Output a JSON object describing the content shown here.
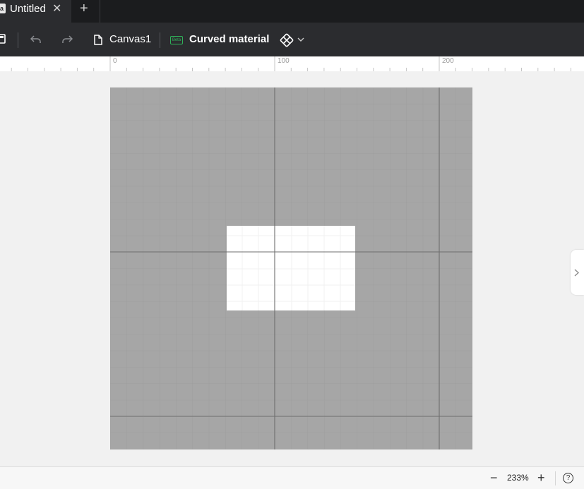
{
  "tab": {
    "title": "Untitled",
    "icon_glyph": "a",
    "close_glyph": "✕",
    "add_glyph": "+"
  },
  "toolbar": {
    "canvas_name": "Canvas1",
    "beta_label": "Beta",
    "material_name": "Curved material",
    "accent_color": "#2fb35a"
  },
  "ruler": {
    "labels": [
      "0",
      "100",
      "200"
    ]
  },
  "status": {
    "zoom": "233%",
    "zoom_out": "−",
    "zoom_in": "+",
    "help": "?"
  },
  "colors": {
    "tabbar": "#1b1c1e",
    "toolbar": "#2b2c2f",
    "board": "#a6a6a6",
    "workpiece": "#ffffff"
  }
}
